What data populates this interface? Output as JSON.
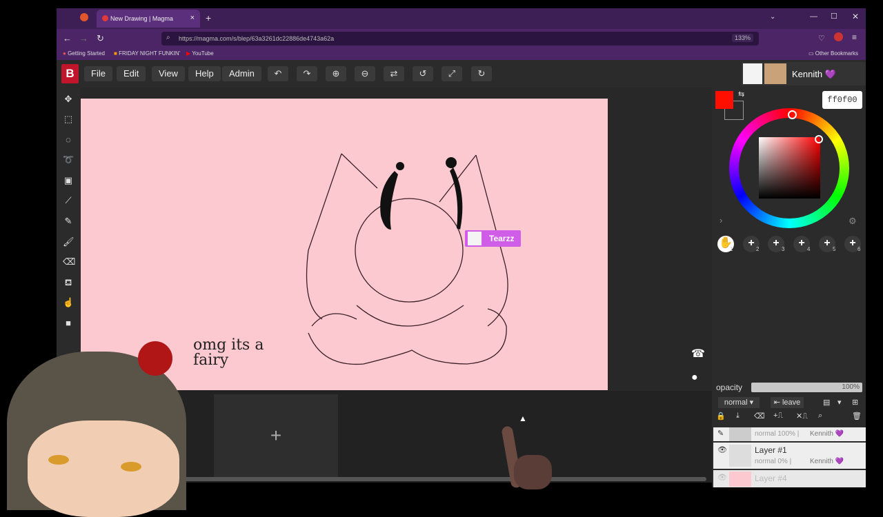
{
  "browser": {
    "tab_title": "New Drawing | Magma",
    "url": "https://magma.com/s/blep/63a3261dc22886de4743a62a",
    "zoom": "133%",
    "bookmarks": [
      "Getting Started",
      "FRIDAY NIGHT FUNKIN'",
      "YouTube"
    ],
    "other_bookmarks": "Other Bookmarks"
  },
  "app": {
    "logo": "B",
    "menu": [
      "File",
      "Edit",
      "View",
      "Help",
      "Admin"
    ],
    "user": "Kennith 💜",
    "cursor_label": "Tearzz",
    "canvas_text": "omg its a fairy"
  },
  "color": {
    "hex": "ff0f00",
    "primary": "#ff0f00",
    "secondary": "#2b2b2b"
  },
  "brushes": [
    "1",
    "2",
    "3",
    "4",
    "5",
    "6"
  ],
  "layers": {
    "opacity_label": "opacity",
    "opacity_value": "100%",
    "blend_mode": "normal",
    "leave_label": "leave",
    "items": [
      {
        "name": "",
        "meta": "normal 100% |",
        "owner": "Kennith 💜"
      },
      {
        "name": "Layer #1",
        "meta": "normal 0% |",
        "owner": "Kennith 💜"
      },
      {
        "name": "Layer #4",
        "meta": "",
        "owner": ""
      }
    ]
  }
}
